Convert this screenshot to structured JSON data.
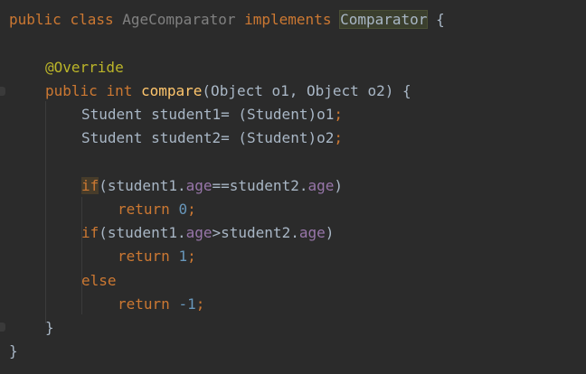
{
  "code": {
    "l1_kw1": "public",
    "l1_kw2": "class",
    "l1_class": "AgeComparator",
    "l1_kw3": "implements",
    "l1_iface": "Comparator",
    "l1_brace": "{",
    "l2_ann": "@Override",
    "l3_kw1": "public",
    "l3_kw2": "int",
    "l3_fn": "compare",
    "l3_params": "(Object o1, Object o2) {",
    "l4_text": "Student student1= (Student)o1",
    "l5_text": "Student student2= (Student)o2",
    "semi": ";",
    "if_kw": "if",
    "paren_open_s1": "(student1.",
    "age": "age",
    "eq_s2": "==student2.",
    "gt_s2": ">student2.",
    "paren_close": ")",
    "return_kw": "return",
    "num0": "0",
    "num1": "1",
    "num_neg": "-1",
    "else_kw": "else",
    "close_method": "}",
    "close_class": "}"
  }
}
